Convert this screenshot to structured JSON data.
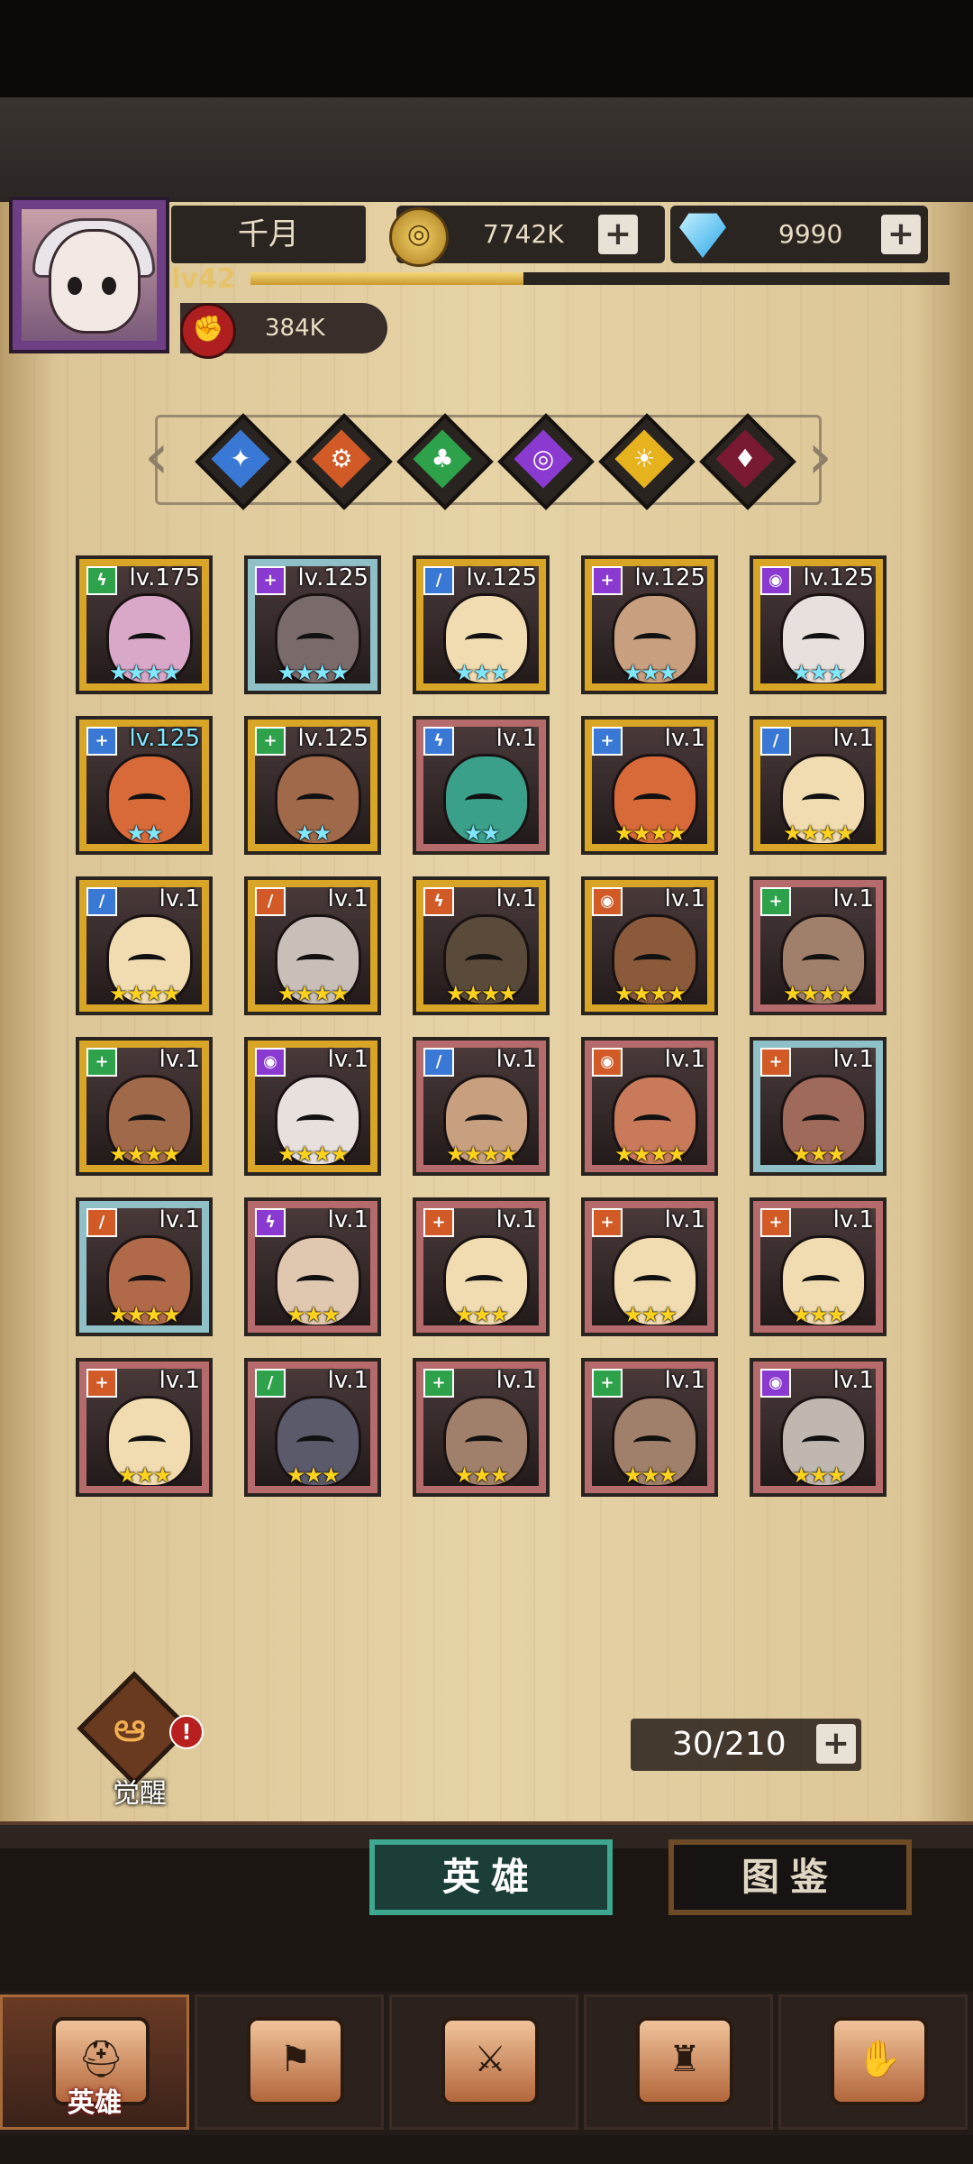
{
  "player": {
    "name": "千月",
    "level": "lv42",
    "xp_progress": 0.39,
    "power": "384K"
  },
  "resources": {
    "gold": "7742K",
    "gems": "9990"
  },
  "factions": [
    {
      "name": "ice",
      "color": "#3a78d6",
      "glyph": "✦"
    },
    {
      "name": "fire",
      "color": "#d25a26",
      "glyph": "⚙"
    },
    {
      "name": "nature",
      "color": "#2ea24a",
      "glyph": "♣"
    },
    {
      "name": "arcane",
      "color": "#8a3ad0",
      "glyph": "◎"
    },
    {
      "name": "light",
      "color": "#e6b21e",
      "glyph": "☀"
    },
    {
      "name": "dark",
      "color": "#7a1a32",
      "glyph": "♦"
    }
  ],
  "heroes": [
    {
      "level": "lv.175",
      "stars": "★★★★",
      "star_color": "#7fe8ff",
      "frame": "gold",
      "class_color": "#2ea24a",
      "class_glyph": "ϟ",
      "skin": "#d9a8c8"
    },
    {
      "level": "lv.125",
      "stars": "★★★★",
      "star_color": "#7fe8ff",
      "frame": "teal",
      "class_color": "#8a3ad0",
      "class_glyph": "+",
      "skin": "#7a6a6a"
    },
    {
      "level": "lv.125",
      "stars": "★★★",
      "star_color": "#7fe8ff",
      "frame": "gold",
      "class_color": "#3a78d6",
      "class_glyph": "/",
      "skin": "#f0dcb0"
    },
    {
      "level": "lv.125",
      "stars": "★★★",
      "star_color": "#7fe8ff",
      "frame": "gold",
      "class_color": "#8a3ad0",
      "class_glyph": "+",
      "skin": "#c8a080"
    },
    {
      "level": "lv.125",
      "stars": "★★★",
      "star_color": "#7fe8ff",
      "frame": "gold",
      "class_color": "#8a3ad0",
      "class_glyph": "◉",
      "skin": "#e8e0dc"
    },
    {
      "level": "lv.125",
      "stars": "★★",
      "star_color": "#7fe8ff",
      "frame": "gold",
      "class_color": "#3a78d6",
      "class_glyph": "+",
      "skin": "#d86a3a"
    },
    {
      "level": "lv.125",
      "stars": "★★",
      "star_color": "#7fe8ff",
      "frame": "gold",
      "class_color": "#2ea24a",
      "class_glyph": "+",
      "skin": "#a06a4a"
    },
    {
      "level": "lv.1",
      "stars": "★★",
      "star_color": "#7fe8ff",
      "frame": "rose",
      "class_color": "#3a78d6",
      "class_glyph": "ϟ",
      "skin": "#3aa08a"
    },
    {
      "level": "lv.1",
      "stars": "★★★★",
      "star_color": "#ffd21e",
      "frame": "gold",
      "class_color": "#3a78d6",
      "class_glyph": "+",
      "skin": "#d86a3a"
    },
    {
      "level": "lv.1",
      "stars": "★★★★",
      "star_color": "#ffd21e",
      "frame": "gold",
      "class_color": "#3a78d6",
      "class_glyph": "/",
      "skin": "#f0dcb0"
    },
    {
      "level": "lv.1",
      "stars": "★★★★",
      "star_color": "#ffd21e",
      "frame": "gold",
      "class_color": "#3a78d6",
      "class_glyph": "/",
      "skin": "#f0dcb0"
    },
    {
      "level": "lv.1",
      "stars": "★★★★",
      "star_color": "#ffd21e",
      "frame": "gold",
      "class_color": "#d25a26",
      "class_glyph": "/",
      "skin": "#c8c0b8"
    },
    {
      "level": "lv.1",
      "stars": "★★★★",
      "star_color": "#ffd21e",
      "frame": "gold",
      "class_color": "#d25a26",
      "class_glyph": "ϟ",
      "skin": "#5a4a3a"
    },
    {
      "level": "lv.1",
      "stars": "★★★★",
      "star_color": "#ffd21e",
      "frame": "gold",
      "class_color": "#d25a26",
      "class_glyph": "◉",
      "skin": "#8a5a3a"
    },
    {
      "level": "lv.1",
      "stars": "★★★★",
      "star_color": "#ffd21e",
      "frame": "rose",
      "class_color": "#2ea24a",
      "class_glyph": "+",
      "skin": "#a0806a"
    },
    {
      "level": "lv.1",
      "stars": "★★★★",
      "star_color": "#ffd21e",
      "frame": "gold",
      "class_color": "#2ea24a",
      "class_glyph": "+",
      "skin": "#a06a4a"
    },
    {
      "level": "lv.1",
      "stars": "★★★★",
      "star_color": "#ffd21e",
      "frame": "gold",
      "class_color": "#8a3ad0",
      "class_glyph": "◉",
      "skin": "#e8e0dc"
    },
    {
      "level": "lv.1",
      "stars": "★★★★",
      "star_color": "#ffd21e",
      "frame": "rose",
      "class_color": "#3a78d6",
      "class_glyph": "/",
      "skin": "#c8a080"
    },
    {
      "level": "lv.1",
      "stars": "★★★★",
      "star_color": "#ffd21e",
      "frame": "rose",
      "class_color": "#d25a26",
      "class_glyph": "◉",
      "skin": "#c87a5a"
    },
    {
      "level": "lv.1",
      "stars": "★★★",
      "star_color": "#ffd21e",
      "frame": "teal",
      "class_color": "#d25a26",
      "class_glyph": "+",
      "skin": "#a06a5a"
    },
    {
      "level": "lv.1",
      "stars": "★★★★",
      "star_color": "#ffd21e",
      "frame": "teal",
      "class_color": "#d25a26",
      "class_glyph": "/",
      "skin": "#b06a4a"
    },
    {
      "level": "lv.1",
      "stars": "★★★",
      "star_color": "#ffd21e",
      "frame": "rose",
      "class_color": "#8a3ad0",
      "class_glyph": "ϟ",
      "skin": "#e0c8b0"
    },
    {
      "level": "lv.1",
      "stars": "★★★",
      "star_color": "#ffd21e",
      "frame": "rose",
      "class_color": "#d25a26",
      "class_glyph": "+",
      "skin": "#f0dcb0"
    },
    {
      "level": "lv.1",
      "stars": "★★★",
      "star_color": "#ffd21e",
      "frame": "rose",
      "class_color": "#d25a26",
      "class_glyph": "+",
      "skin": "#f0dcb0"
    },
    {
      "level": "lv.1",
      "stars": "★★★",
      "star_color": "#ffd21e",
      "frame": "rose",
      "class_color": "#d25a26",
      "class_glyph": "+",
      "skin": "#f0dcb0"
    },
    {
      "level": "lv.1",
      "stars": "★★★",
      "star_color": "#ffd21e",
      "frame": "rose",
      "class_color": "#d25a26",
      "class_glyph": "+",
      "skin": "#f0dcb0"
    },
    {
      "level": "lv.1",
      "stars": "★★★",
      "star_color": "#ffd21e",
      "frame": "rose",
      "class_color": "#2ea24a",
      "class_glyph": "/",
      "skin": "#5a5a6a"
    },
    {
      "level": "lv.1",
      "stars": "★★★",
      "star_color": "#ffd21e",
      "frame": "rose",
      "class_color": "#2ea24a",
      "class_glyph": "+",
      "skin": "#a0806a"
    },
    {
      "level": "lv.1",
      "stars": "★★★",
      "star_color": "#ffd21e",
      "frame": "rose",
      "class_color": "#2ea24a",
      "class_glyph": "+",
      "skin": "#a0806a"
    },
    {
      "level": "lv.1",
      "stars": "★★★",
      "star_color": "#ffd21e",
      "frame": "rose",
      "class_color": "#8a3ad0",
      "class_glyph": "◉",
      "skin": "#c0b8b0"
    }
  ],
  "awaken": {
    "label": "觉醒",
    "badge": "!"
  },
  "roster_count": "30/210",
  "tabs": {
    "heroes": "英雄",
    "handbook": "图鉴"
  },
  "bottom_nav": [
    {
      "icon": "helmet-icon",
      "glyph": "⛑",
      "label": "英雄",
      "active": true
    },
    {
      "icon": "flag-icon",
      "glyph": "⚑",
      "label": "",
      "active": false
    },
    {
      "icon": "crossed-swords-icon",
      "glyph": "⚔",
      "label": "",
      "active": false
    },
    {
      "icon": "castle-icon",
      "glyph": "♜",
      "label": "",
      "active": false
    },
    {
      "icon": "handshake-icon",
      "glyph": "✋",
      "label": "",
      "active": false
    }
  ]
}
